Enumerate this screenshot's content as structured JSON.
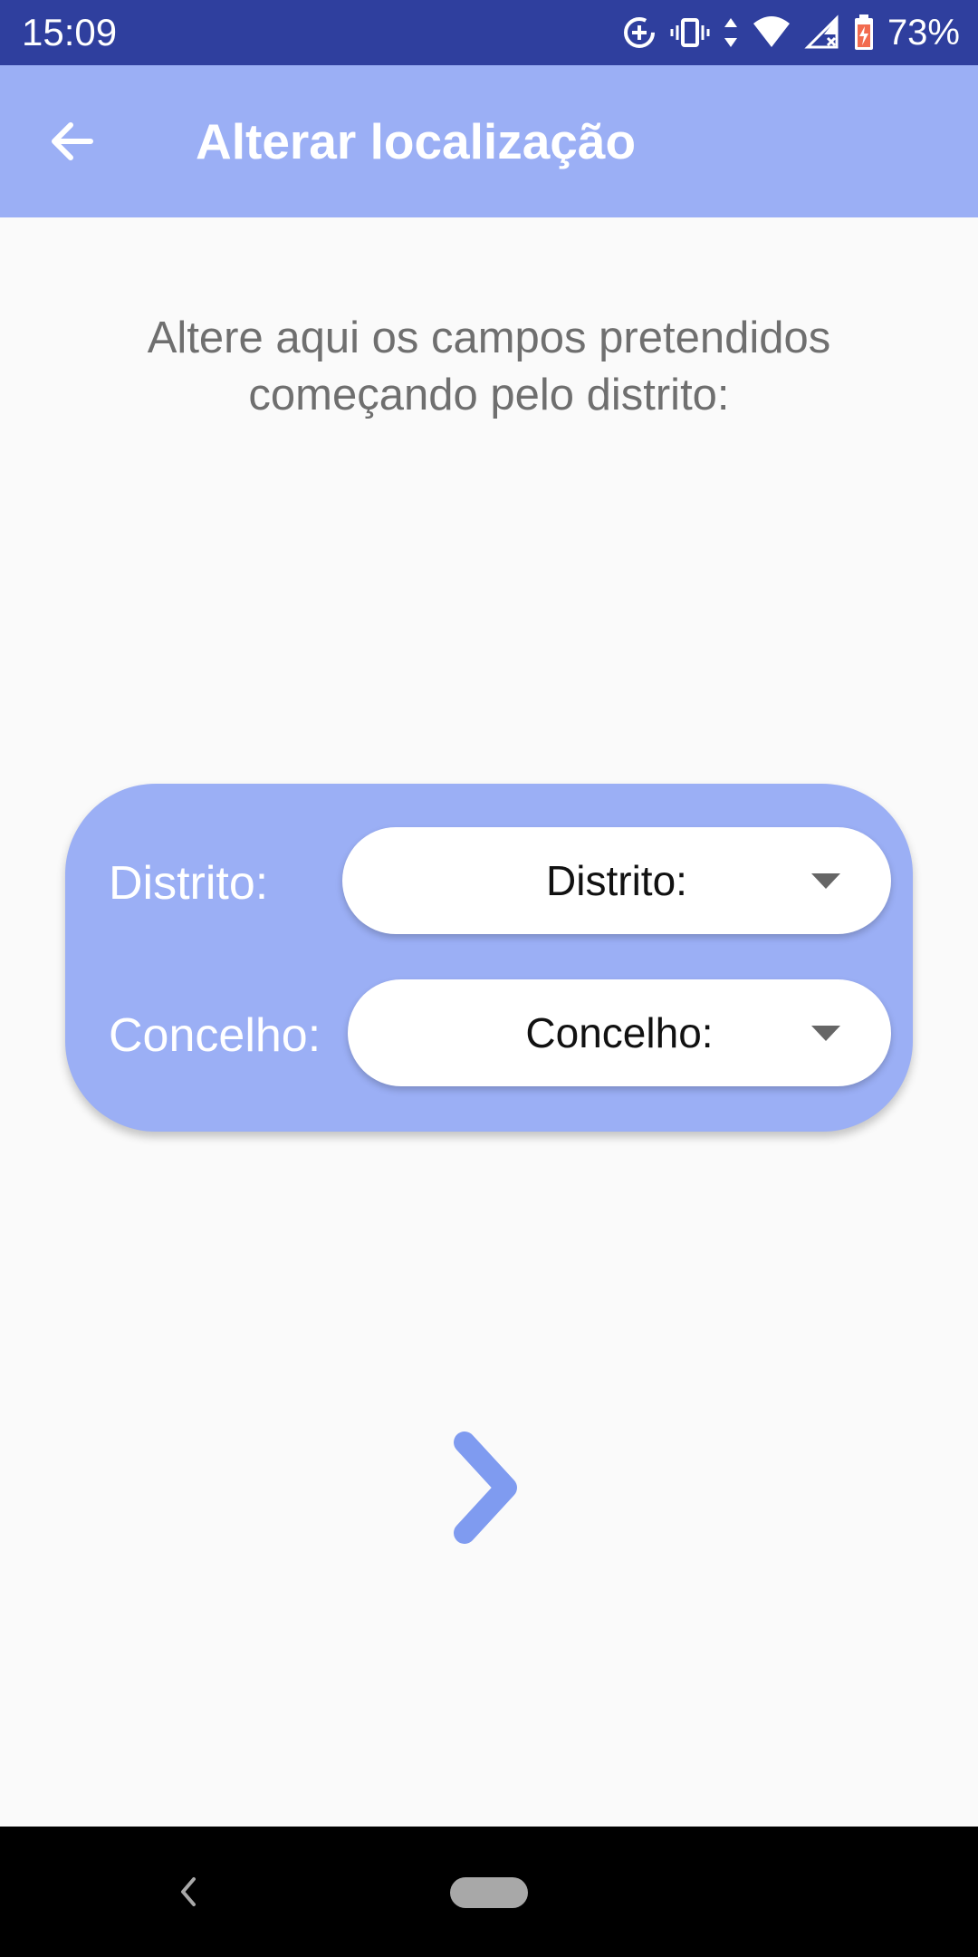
{
  "status_bar": {
    "time": "15:09",
    "battery_percent": "73%",
    "icons": [
      "data-saver-icon",
      "vibrate-icon",
      "data-transfer-icon",
      "wifi-icon",
      "cellular-no-signal-icon",
      "battery-charging-icon"
    ]
  },
  "app_bar": {
    "title": "Alterar localização",
    "back_icon": "arrow-back-icon"
  },
  "instruction": {
    "text": "Altere aqui os campos pretendidos começando pelo distrito:"
  },
  "form": {
    "district": {
      "label": "Distrito:",
      "selected": "Distrito:"
    },
    "municipality": {
      "label": "Concelho:",
      "selected": "Concelho:"
    }
  },
  "next_button": {
    "icon": "chevron-right-icon"
  },
  "colors": {
    "status_bar": "#2f3f9e",
    "primary": "#9baff5",
    "accent": "#7f9bf0",
    "background": "#fafafa"
  }
}
